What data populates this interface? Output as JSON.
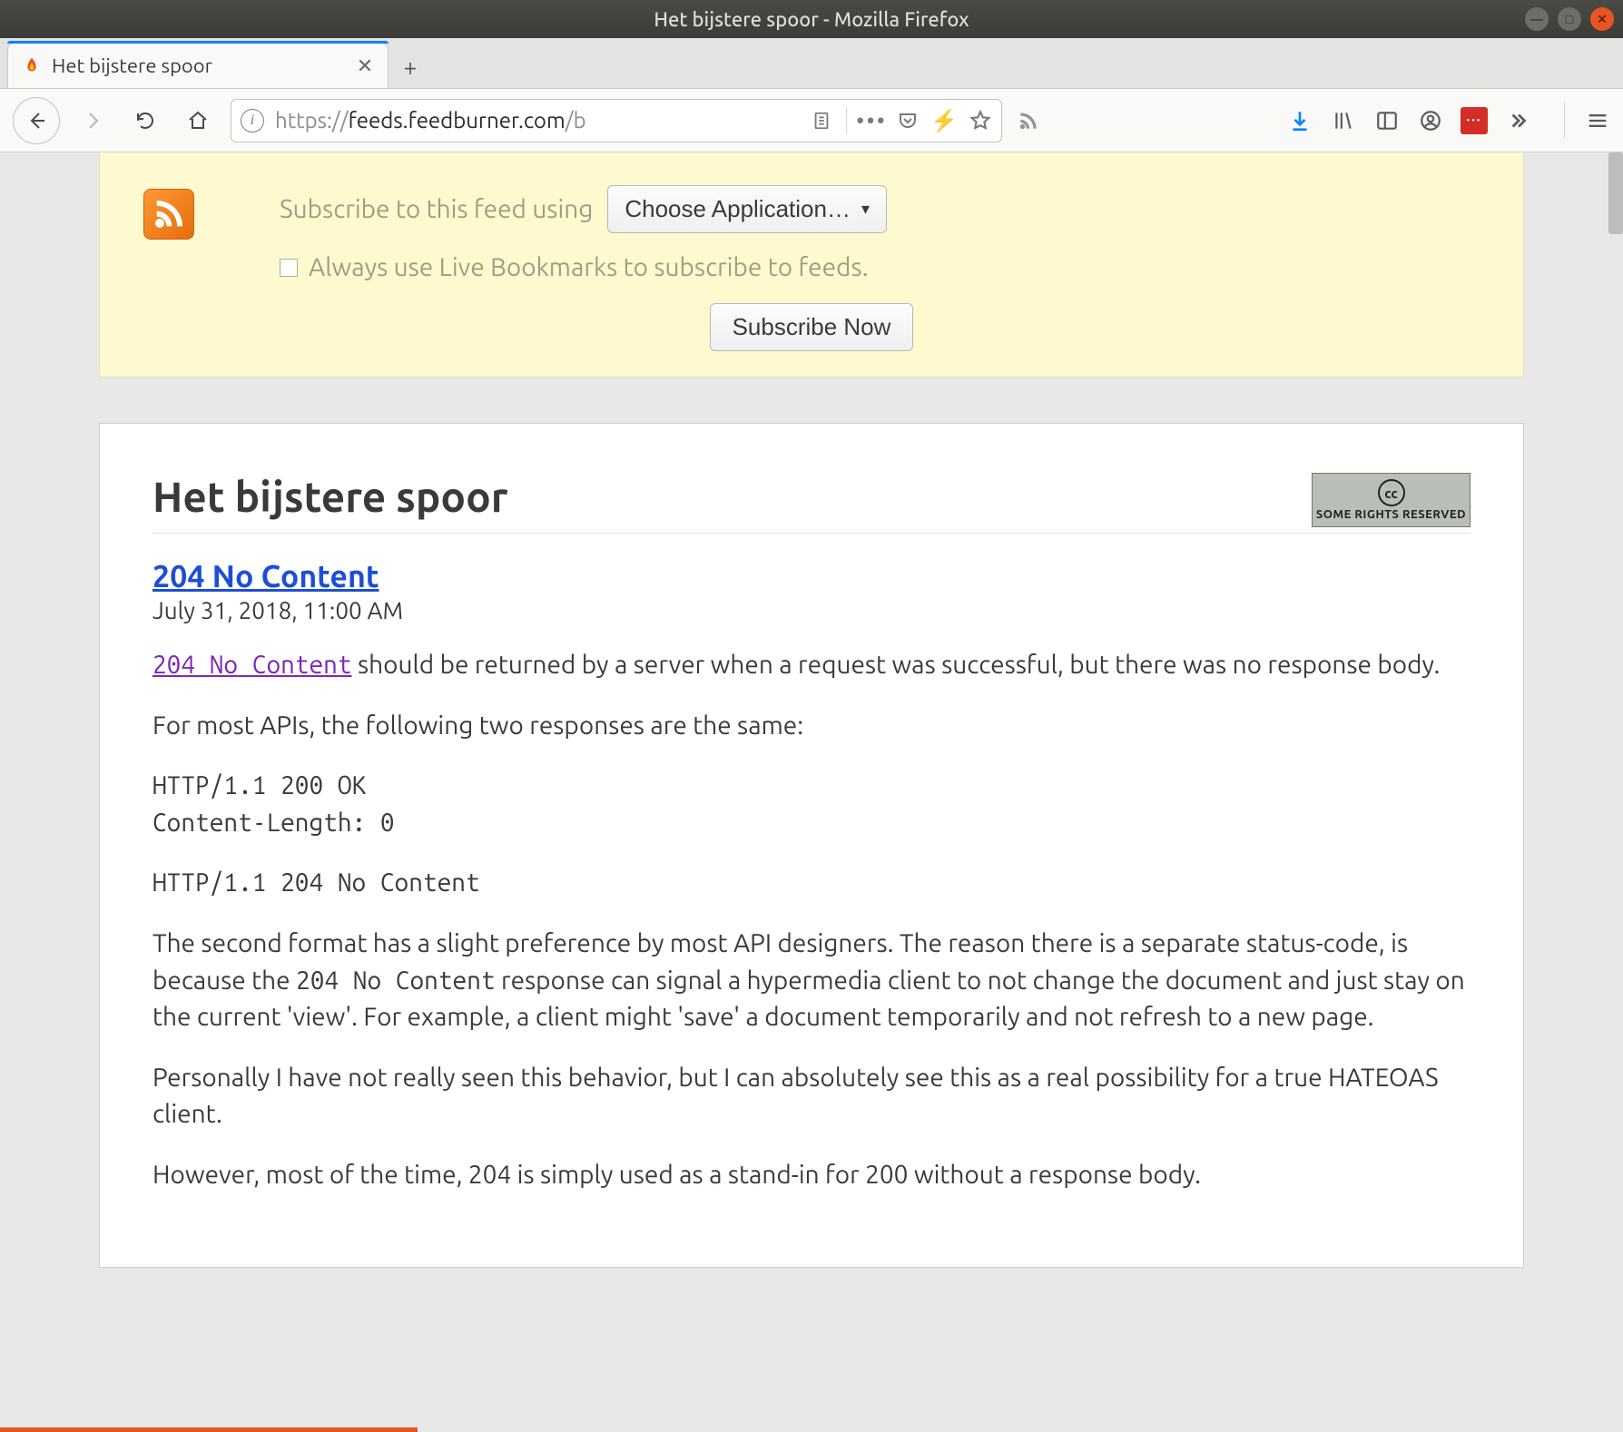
{
  "window": {
    "title": "Het bijstere spoor - Mozilla Firefox"
  },
  "tab": {
    "title": "Het bijstere spoor"
  },
  "url": {
    "prefix": "https://",
    "host": "feeds.feedburner.com",
    "path": "/b"
  },
  "subscribe": {
    "label": "Subscribe to this feed using",
    "choose": "Choose Application…",
    "always": "Always use Live Bookmarks to subscribe to feeds.",
    "now": "Subscribe Now"
  },
  "feed": {
    "title": "Het bijstere spoor",
    "cc": "SOME RIGHTS RESERVED",
    "cc_inner": "cc",
    "entry": {
      "title": "204 No Content",
      "date": "July 31, 2018, 11:00 AM",
      "link_text": "204 No Content",
      "p1_rest": " should be returned by a server when a request was successful, but there was no response body.",
      "p2": "For most APIs, the following two responses are the same:",
      "pre1": "HTTP/1.1 200 OK\nContent-Length: 0",
      "pre2": "HTTP/1.1 204 No Content",
      "p3a": "The second format has a slight preference by most API designers. The reason there is a separate status-code, is because the ",
      "p3code": "204 No Content",
      "p3b": " response can signal a hypermedia client to not change the document and just stay on the current 'view'. For example, a client might 'save' a document temporarily and not refresh to a new page.",
      "p4": "Personally I have not really seen this behavior, but I can absolutely see this as a real possibility for a true HATEOAS client.",
      "p5": "However, most of the time, 204 is simply used as a stand-in for 200 without a response body."
    }
  }
}
